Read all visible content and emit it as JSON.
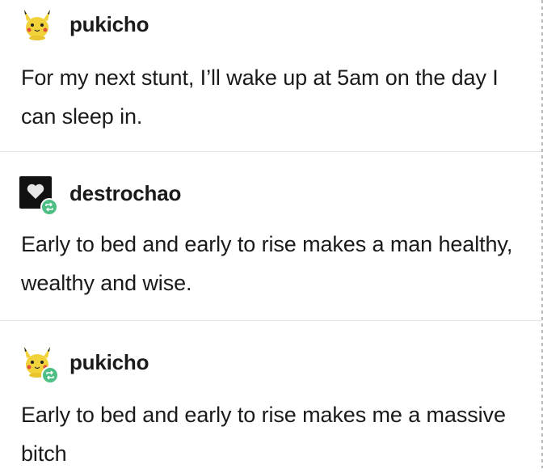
{
  "posts": [
    {
      "username": "pukicho",
      "avatar": "pikachu-avatar",
      "reblog": false,
      "text": "For my next stunt, I’ll wake up at 5am on the day I can sleep in."
    },
    {
      "username": "destrochao",
      "avatar": "black-heart-avatar",
      "reblog": true,
      "text": "Early to bed and early to rise makes a man healthy, wealthy and wise."
    },
    {
      "username": "pukicho",
      "avatar": "pikachu-avatar",
      "reblog": true,
      "text": "Early to bed and early to rise makes me a massive bitch"
    }
  ],
  "colors": {
    "reblog_badge": "#4dbf84",
    "divider": "#e3e3e3",
    "text": "#1a1a1a",
    "avatar_yellow": "#f2d23a"
  }
}
